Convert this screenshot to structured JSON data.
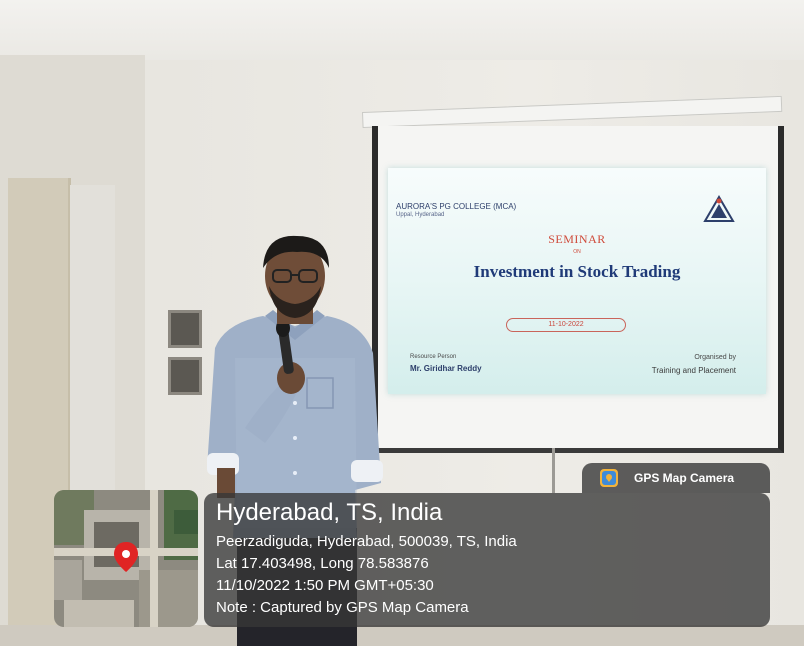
{
  "slide": {
    "college": "AURORA'S PG COLLEGE (MCA)",
    "college_sub": "Uppal, Hyderabad",
    "heading": "SEMINAR",
    "on": "ON",
    "topic": "Investment in Stock Trading",
    "date": "11-10-2022",
    "resource_label": "Resource Person",
    "resource_name": "Mr. Giridhar Reddy",
    "organised_label": "Organised by",
    "organised_name": "Training and Placement"
  },
  "gps": {
    "app_name": "GPS Map Camera",
    "city": "Hyderabad, TS, India",
    "address": "Peerzadiguda, Hyderabad, 500039, TS, India",
    "coords": "Lat 17.403498, Long 78.583876",
    "datetime": "11/10/2022 1:50 PM GMT+05:30",
    "note": "Note : Captured by GPS Map Camera"
  },
  "colors": {
    "seminar_red": "#cf4a3a",
    "topic_blue": "#1f3a78",
    "overlay_bg": "#373737",
    "pin_red": "#e02424"
  },
  "icons": [
    "gps-camera-app-icon",
    "map-pin-icon"
  ]
}
